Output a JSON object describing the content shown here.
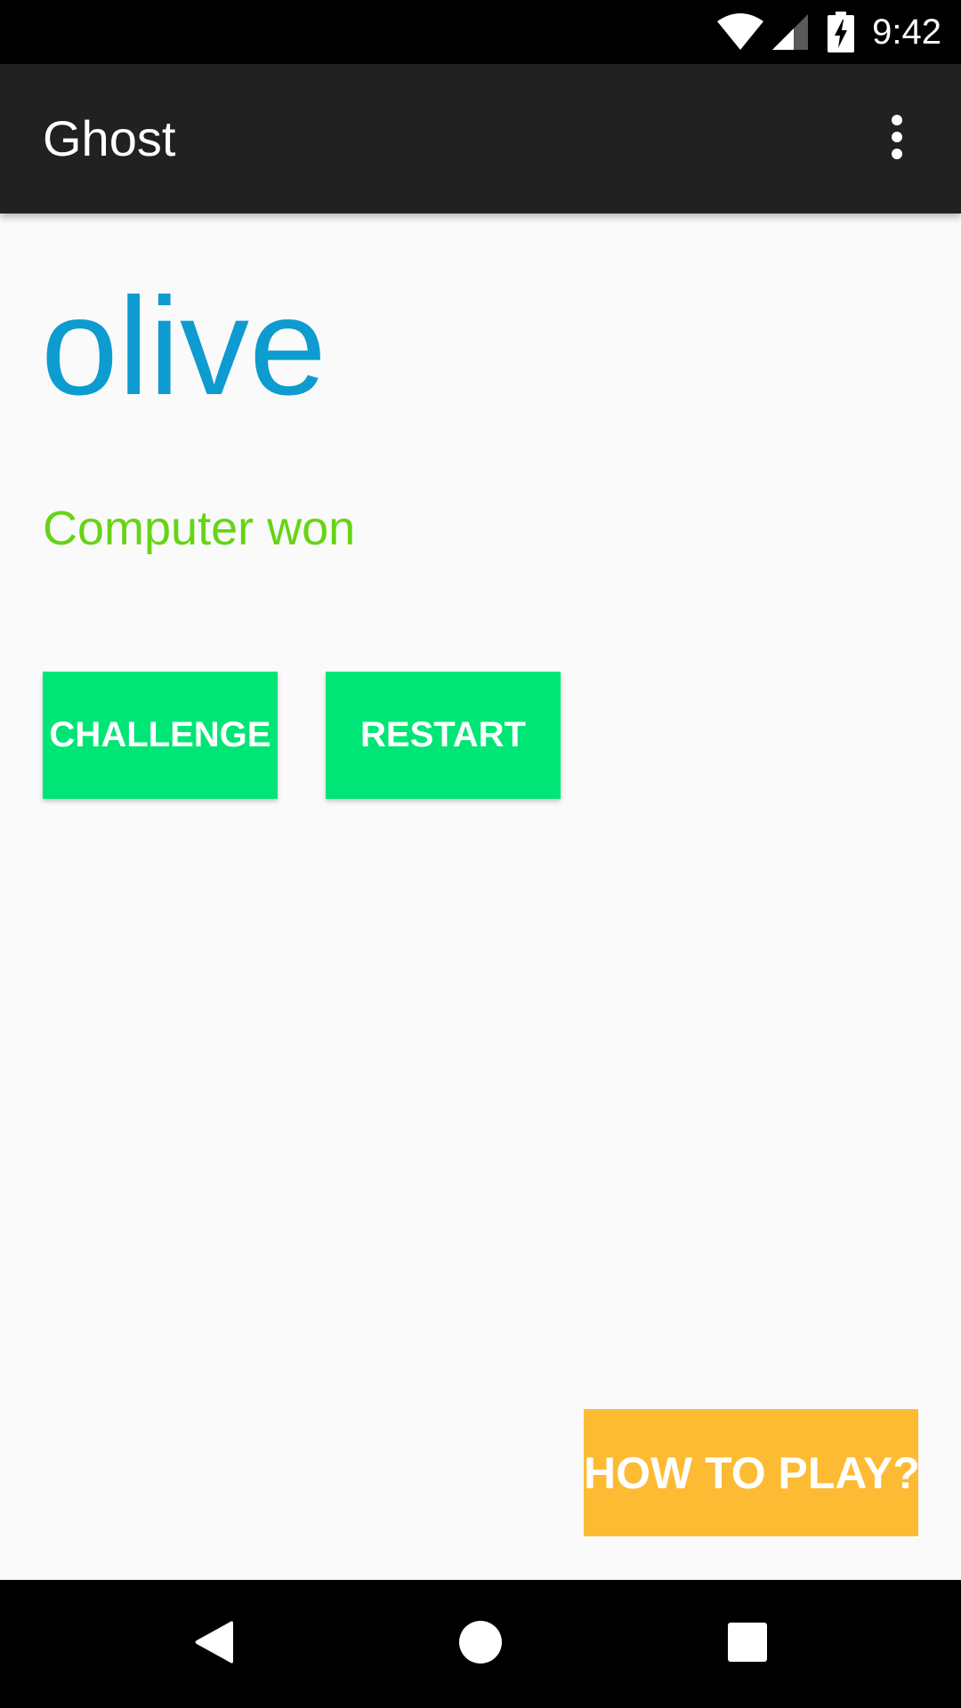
{
  "status_bar": {
    "time": "9:42",
    "icons": [
      "wifi-icon",
      "cell-signal-icon",
      "battery-charging-icon"
    ]
  },
  "app_bar": {
    "title": "Ghost",
    "menu_icon": "more-vert-icon"
  },
  "game": {
    "word": "olive",
    "status": "Computer won"
  },
  "buttons": {
    "challenge_label": "CHALLENGE",
    "restart_label": "RESTART",
    "how_to_play_label": "HOW TO PLAY?"
  },
  "nav_bar": {
    "icons": [
      "back-icon",
      "home-icon",
      "recents-icon"
    ]
  },
  "colors": {
    "word": "#0e9bd0",
    "status": "#66d414",
    "accent": "#00e676",
    "how_to_play": "#fdbb33",
    "app_bar": "#212121"
  }
}
